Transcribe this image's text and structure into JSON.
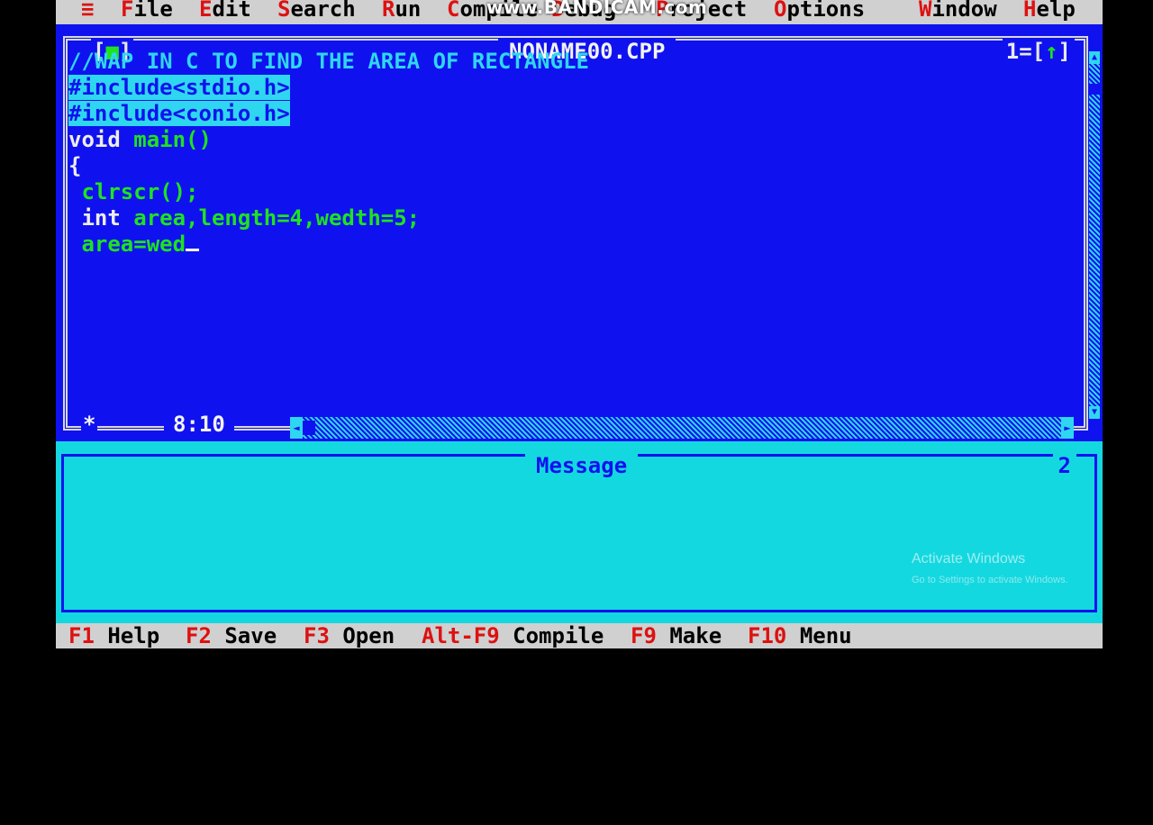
{
  "menu": {
    "system": "≡",
    "items": [
      {
        "hot": "F",
        "rest": "ile"
      },
      {
        "hot": "E",
        "rest": "dit"
      },
      {
        "hot": "S",
        "rest": "earch"
      },
      {
        "hot": "R",
        "rest": "un"
      },
      {
        "hot": "C",
        "rest": "ompile"
      },
      {
        "hot": "D",
        "rest": "ebug"
      },
      {
        "hot": "P",
        "rest": "roject"
      },
      {
        "hot": "O",
        "rest": "ptions"
      },
      {
        "hot": "W",
        "rest": "indow"
      },
      {
        "hot": "H",
        "rest": "elp"
      }
    ]
  },
  "watermark": "www.BANDICAM.com",
  "editor": {
    "filename": "NONAME00.CPP",
    "close_box": "■",
    "window_number": "1",
    "zoom_arrow": "↑",
    "cursor_pos": "8:10",
    "modified_marker": "*",
    "lines": [
      "//WAP IN C TO FIND THE AREA OF RECTANGLE",
      "#include<stdio.h>",
      "#include<conio.h>",
      {
        "kw": "void",
        "rest": " main()"
      },
      "{",
      " clrscr();",
      {
        "kw": " int",
        "rest": " area,length=4,wedth=5;"
      },
      " area=wed"
    ]
  },
  "message": {
    "title": "Message",
    "number": "2"
  },
  "fkeys": [
    {
      "key": "F1",
      "label": "Help"
    },
    {
      "key": "F2",
      "label": "Save"
    },
    {
      "key": "F3",
      "label": "Open"
    },
    {
      "key": "Alt-F9",
      "label": "Compile"
    },
    {
      "key": "F9",
      "label": "Make"
    },
    {
      "key": "F10",
      "label": "Menu"
    }
  ],
  "os_overlay": {
    "title": "Activate Windows",
    "subtitle": "Go to Settings to activate Windows."
  },
  "colors": {
    "editor_bg": "#0f12ee",
    "message_bg": "#14d8e0",
    "menu_bg": "#d0d0d0",
    "hotkey": "#d11111"
  }
}
